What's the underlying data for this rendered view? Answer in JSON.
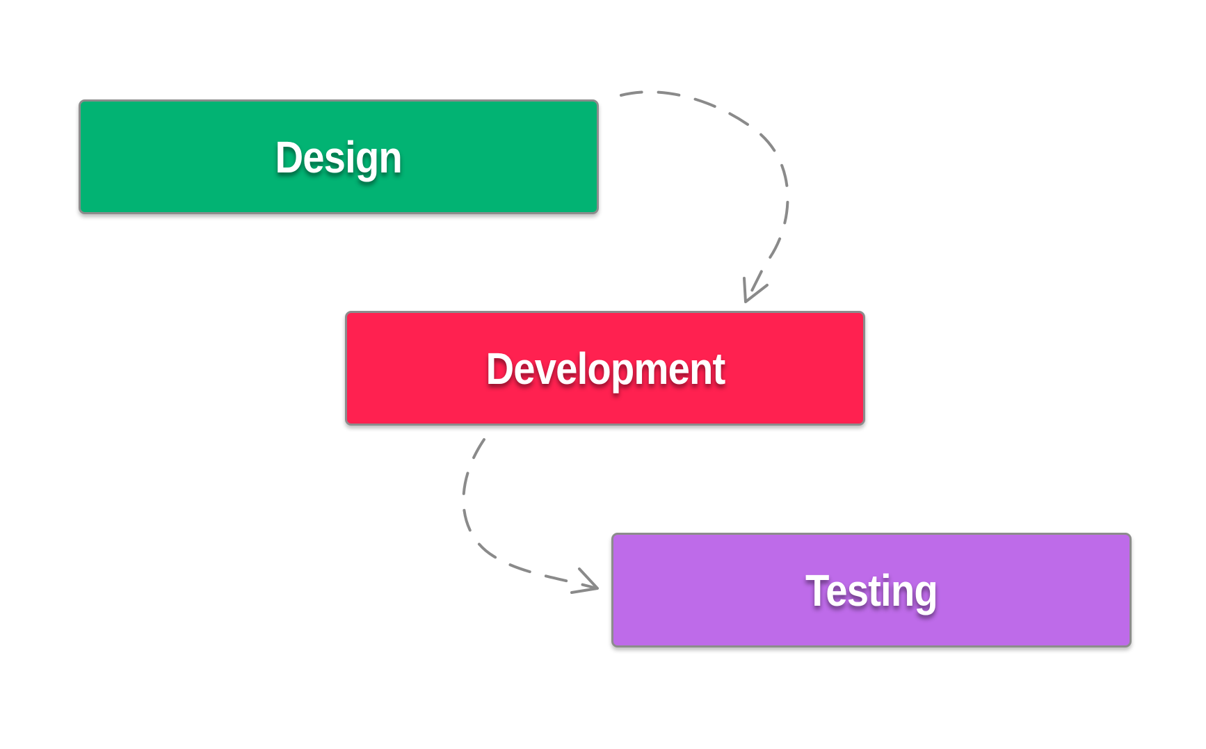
{
  "steps": [
    {
      "label": "Design",
      "color": "#02b373"
    },
    {
      "label": "Development",
      "color": "#ff2150"
    },
    {
      "label": "Testing",
      "color": "#be6be9"
    }
  ],
  "connectors": [
    {
      "from": "Design",
      "to": "Development",
      "style": "dashed",
      "color": "#8a8a8a"
    },
    {
      "from": "Development",
      "to": "Testing",
      "style": "dashed",
      "color": "#8a8a8a"
    }
  ]
}
